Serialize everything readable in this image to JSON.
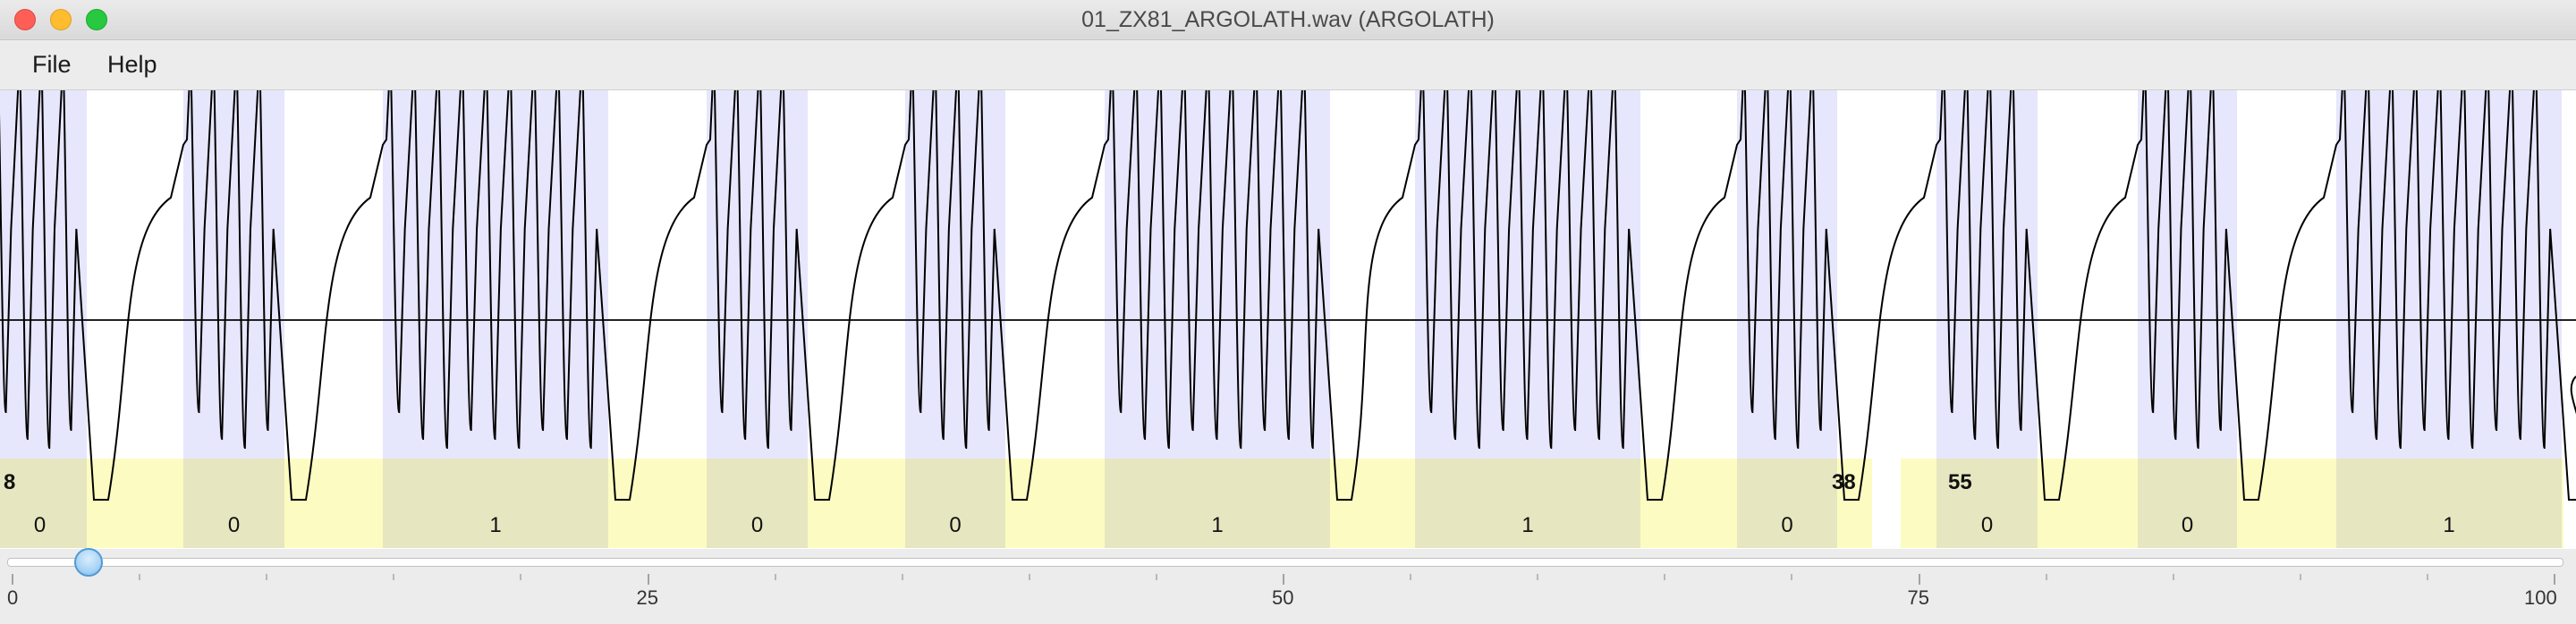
{
  "window": {
    "title": "01_ZX81_ARGOLATH.wav (ARGOLATH)"
  },
  "menu": {
    "items": [
      {
        "label": "File"
      },
      {
        "label": "Help"
      }
    ]
  },
  "waveform": {
    "segments": [
      {
        "kind": "bit",
        "bit": "0",
        "pulses": 4
      },
      {
        "kind": "bit",
        "bit": "0",
        "pulses": 4
      },
      {
        "kind": "bit",
        "bit": "1",
        "pulses": 9
      },
      {
        "kind": "bit",
        "bit": "0",
        "pulses": 4
      },
      {
        "kind": "bit",
        "bit": "0",
        "pulses": 4
      },
      {
        "kind": "bit",
        "bit": "1",
        "pulses": 9
      },
      {
        "kind": "bit",
        "bit": "1",
        "pulses": 9
      },
      {
        "kind": "bit",
        "bit": "0",
        "pulses": 4
      },
      {
        "kind": "bit",
        "bit": "0",
        "pulses": 4
      },
      {
        "kind": "bit",
        "bit": "0",
        "pulses": 4
      },
      {
        "kind": "bit",
        "bit": "1",
        "pulses": 9
      }
    ],
    "byte_values": [
      {
        "value": "8",
        "bold": true
      },
      {
        "value": "38",
        "bold": true
      },
      {
        "value": "55",
        "bold": true
      }
    ],
    "colors": {
      "pulse_band": "#e6e6fc",
      "byte_band": "#fcfcc2",
      "overlap": "#e6e6c0",
      "signal": "#000000"
    }
  },
  "scrollbar": {
    "position_percent": 3,
    "min": 0,
    "max": 100,
    "tick_labels": [
      "0",
      "25",
      "50",
      "75",
      "100"
    ]
  }
}
